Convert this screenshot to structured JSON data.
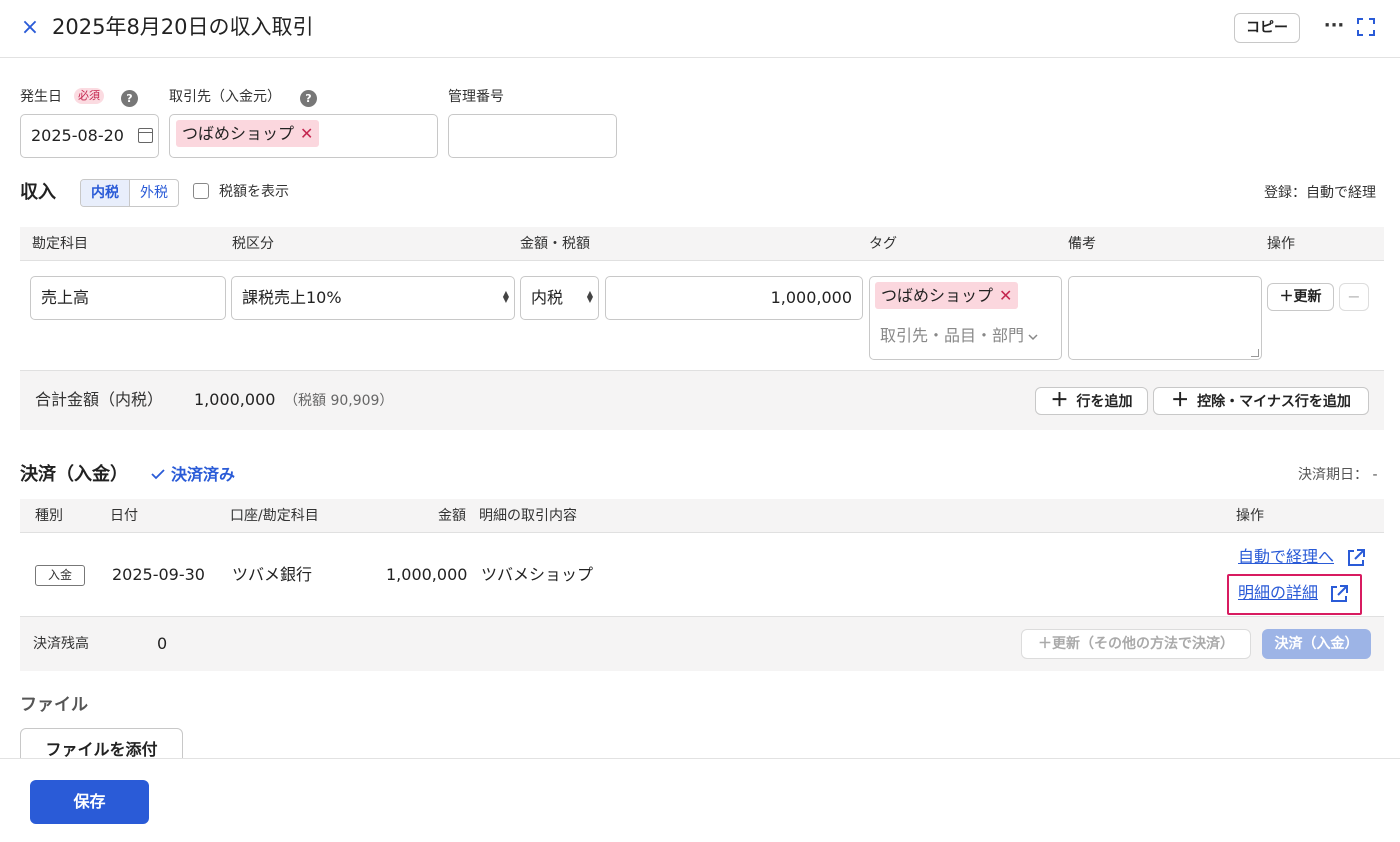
{
  "header": {
    "title": "2025年8月20日の収入取引",
    "close_icon": "×",
    "copy_label": "コピー",
    "more_icon": "···"
  },
  "form": {
    "date_label": "発生日",
    "required_badge": "必須",
    "date_value": "2025-08-20",
    "partner_label": "取引先（入金元）",
    "partner_chip": "つばめショップ",
    "chip_remove": "✕",
    "mgmt_label": "管理番号",
    "help_icon": "?"
  },
  "income": {
    "title": "収入",
    "tax_mode_in": "内税",
    "tax_mode_out": "外税",
    "show_tax_label": "税額を表示",
    "registration_note": "登録：自動で経理",
    "columns": [
      "勘定科目",
      "税区分",
      "金額・税額",
      "タグ",
      "備考",
      "操作"
    ],
    "row": {
      "account": "売上高",
      "tax_category": "課税売上10%",
      "tax_type": "内税",
      "amount": "1,000,000",
      "tag_chip": "つばめショップ",
      "tag_placeholder": "取引先・品目・部門",
      "update_label": "＋更新",
      "remove_label": "−"
    },
    "totals": {
      "label": "合計金額（内税）",
      "value": "1,000,000",
      "tax_note": "（税額 90,909）",
      "add_row_label": "行を追加",
      "add_minus_label": "控除・マイナス行を追加"
    }
  },
  "payment": {
    "title": "決済（入金）",
    "status": "決済済み",
    "due_note": "決済期日： -",
    "columns": [
      "種別",
      "日付",
      "口座/勘定科目",
      "金額",
      "明細の取引内容",
      "操作"
    ],
    "row": {
      "type": "入金",
      "date": "2025-09-30",
      "account": "ツバメ銀行",
      "amount": "1,000,000",
      "description": "ツバメショップ",
      "link_auto": "自動で経理へ",
      "link_detail": "明細の詳細"
    },
    "balance_label": "決済残高",
    "balance_value": "0",
    "update_other_label": "＋更新（その他の方法で決済）",
    "pay_label": "決済（入金）"
  },
  "files": {
    "title": "ファイル",
    "attach_label": "ファイルを添付"
  },
  "footer": {
    "save_label": "保存"
  },
  "colors": {
    "accent": "#2a5bd7",
    "chip_bg": "#fbd7de",
    "highlight": "#d81b60"
  }
}
